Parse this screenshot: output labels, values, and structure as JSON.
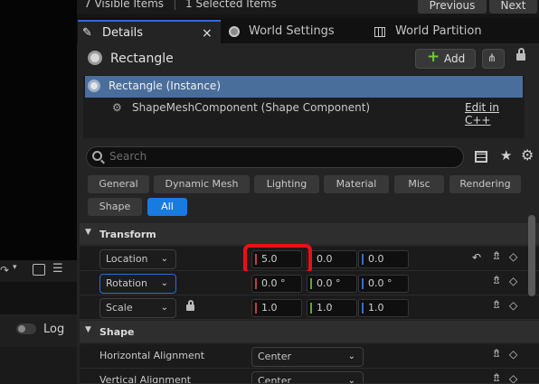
{
  "topbar": {
    "visible_items": "7 Visible Items",
    "selected_items": "1 Selected Items",
    "previous": "Previous",
    "next": "Next"
  },
  "tabs": [
    {
      "label": "Details",
      "close": "×"
    },
    {
      "label": "World Settings"
    },
    {
      "label": "World Partition"
    }
  ],
  "header": {
    "title": "Rectangle",
    "add_label": "Add"
  },
  "components": {
    "instance": "Rectangle (Instance)",
    "child": "ShapeMeshComponent (Shape Component)",
    "edit_link": "Edit in C++"
  },
  "search": {
    "placeholder": "Search"
  },
  "filters": [
    "General",
    "Dynamic Mesh",
    "Lighting",
    "Material",
    "Misc",
    "Rendering",
    "Shape",
    "All"
  ],
  "transform": {
    "title": "Transform",
    "location": {
      "label": "Location",
      "x": "5.0",
      "y": "0.0",
      "z": "0.0"
    },
    "rotation": {
      "label": "Rotation",
      "x": "0.0 °",
      "y": "0.0 °",
      "z": "0.0 °"
    },
    "scale": {
      "label": "Scale",
      "x": "1.0",
      "y": "1.0",
      "z": "1.0"
    }
  },
  "shape": {
    "title": "Shape",
    "horizontal": {
      "label": "Horizontal Alignment",
      "value": "Center"
    },
    "vertical": {
      "label": "Vertical Alignment",
      "value": "Center"
    }
  },
  "left": {
    "log_label": "Log"
  },
  "colors": {
    "accent": "#1a7bde",
    "highlight": "#e8101a",
    "selection": "#4a6e9c"
  }
}
